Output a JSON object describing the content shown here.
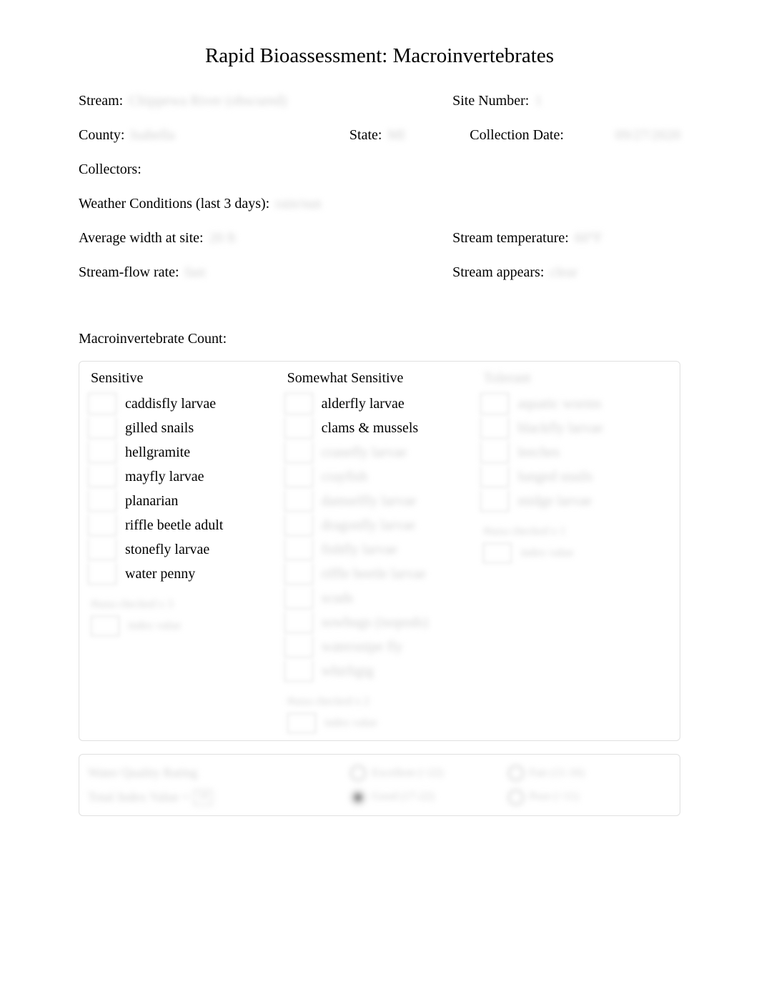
{
  "title": "Rapid Bioassessment: Macroinvertebrates",
  "header": {
    "stream_label": "Stream:",
    "stream_value": "Chippewa River (obscured)",
    "site_number_label": "Site Number:",
    "site_number_value": "1",
    "county_label": "County:",
    "county_value": "Isabella",
    "state_label": "State:",
    "state_value": "MI",
    "collection_date_label": "Collection Date:",
    "collection_date_value": "09/27/2020",
    "collectors_label": "Collectors:",
    "collectors_value": "",
    "weather_label": "Weather Conditions (last 3 days):",
    "weather_value": "rain/sun",
    "avg_width_label": "Average width at site:",
    "avg_width_value": "20 ft",
    "stream_temp_label": "Stream temperature:",
    "stream_temp_value": "60°F",
    "flow_rate_label": "Stream-flow rate:",
    "flow_rate_value": "fast",
    "stream_appears_label": "Stream appears:",
    "stream_appears_value": "clear"
  },
  "count_section_title": "Macroinvertebrate Count:",
  "columns": {
    "sensitive": {
      "header": "Sensitive",
      "items": [
        {
          "count": "",
          "name": "caddisfly larvae"
        },
        {
          "count": "",
          "name": "gilled snails"
        },
        {
          "count": "",
          "name": "hellgramite"
        },
        {
          "count": "",
          "name": "mayfly larvae"
        },
        {
          "count": "",
          "name": "planarian"
        },
        {
          "count": "",
          "name": "riffle beetle adult"
        },
        {
          "count": "",
          "name": "stonefly larvae"
        },
        {
          "count": "",
          "name": "water penny"
        }
      ],
      "calc": "#taxa checked x 3",
      "index": "",
      "index_label": "index value"
    },
    "somewhat": {
      "header": "Somewhat Sensitive",
      "items": [
        {
          "count": "",
          "name": "alderfly larvae"
        },
        {
          "count": "",
          "name": "clams & mussels"
        },
        {
          "count": "",
          "name": "cranefly larvae"
        },
        {
          "count": "",
          "name": "crayfish"
        },
        {
          "count": "",
          "name": "damselfly larvae"
        },
        {
          "count": "",
          "name": "dragonfly larvae"
        },
        {
          "count": "",
          "name": "fishfly larvae"
        },
        {
          "count": "",
          "name": "riffle beetle larvae"
        },
        {
          "count": "",
          "name": "scuds"
        },
        {
          "count": "",
          "name": "sowbugs (isopods)"
        },
        {
          "count": "",
          "name": "watersnipe fly"
        },
        {
          "count": "",
          "name": "whirligig"
        }
      ],
      "calc": "#taxa checked x 2",
      "index": "",
      "index_label": "index value"
    },
    "tolerant": {
      "header": "Tolerant",
      "items": [
        {
          "count": "",
          "name": "aquatic worms"
        },
        {
          "count": "",
          "name": "blackfly larvae"
        },
        {
          "count": "",
          "name": "leeches"
        },
        {
          "count": "",
          "name": "lunged snails"
        },
        {
          "count": "",
          "name": "midge larvae"
        }
      ],
      "calc": "#taxa checked x 1",
      "index": "",
      "index_label": "index value"
    }
  },
  "rating": {
    "row1_label": "Water Quality Rating",
    "row1_opt1": "Excellent (>22)",
    "row1_opt2": "Fair (11-16)",
    "row2_label": "Total Index Value =",
    "row2_value": "18",
    "row2_opt1": "Good (17-22)",
    "row2_opt2": "Poor (<11)"
  }
}
